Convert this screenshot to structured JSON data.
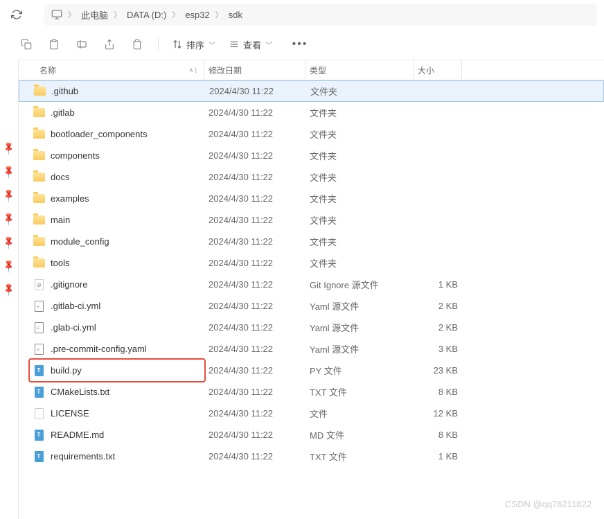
{
  "breadcrumb": {
    "items": [
      "此电脑",
      "DATA (D:)",
      "esp32",
      "sdk"
    ]
  },
  "toolbar": {
    "sort": "排序",
    "view": "查看"
  },
  "columns": {
    "name": "名称",
    "date": "修改日期",
    "type": "类型",
    "size": "大小"
  },
  "files": [
    {
      "name": ".github",
      "date": "2024/4/30 11:22",
      "type": "文件夹",
      "size": "",
      "icon": "folder",
      "selected": true
    },
    {
      "name": ".gitlab",
      "date": "2024/4/30 11:22",
      "type": "文件夹",
      "size": "",
      "icon": "folder"
    },
    {
      "name": "bootloader_components",
      "date": "2024/4/30 11:22",
      "type": "文件夹",
      "size": "",
      "icon": "folder"
    },
    {
      "name": "components",
      "date": "2024/4/30 11:22",
      "type": "文件夹",
      "size": "",
      "icon": "folder"
    },
    {
      "name": "docs",
      "date": "2024/4/30 11:22",
      "type": "文件夹",
      "size": "",
      "icon": "folder"
    },
    {
      "name": "examples",
      "date": "2024/4/30 11:22",
      "type": "文件夹",
      "size": "",
      "icon": "folder"
    },
    {
      "name": "main",
      "date": "2024/4/30 11:22",
      "type": "文件夹",
      "size": "",
      "icon": "folder"
    },
    {
      "name": "module_config",
      "date": "2024/4/30 11:22",
      "type": "文件夹",
      "size": "",
      "icon": "folder"
    },
    {
      "name": "tools",
      "date": "2024/4/30 11:22",
      "type": "文件夹",
      "size": "",
      "icon": "folder"
    },
    {
      "name": ".gitignore",
      "date": "2024/4/30 11:22",
      "type": "Git Ignore 源文件",
      "size": "1 KB",
      "icon": "git"
    },
    {
      "name": ".gitlab-ci.yml",
      "date": "2024/4/30 11:22",
      "type": "Yaml 源文件",
      "size": "2 KB",
      "icon": "txt"
    },
    {
      "name": ".glab-ci.yml",
      "date": "2024/4/30 11:22",
      "type": "Yaml 源文件",
      "size": "2 KB",
      "icon": "txt"
    },
    {
      "name": ".pre-commit-config.yaml",
      "date": "2024/4/30 11:22",
      "type": "Yaml 源文件",
      "size": "3 KB",
      "icon": "txt"
    },
    {
      "name": "build.py",
      "date": "2024/4/30 11:22",
      "type": "PY 文件",
      "size": "23 KB",
      "icon": "blue",
      "highlighted": true
    },
    {
      "name": "CMakeLists.txt",
      "date": "2024/4/30 11:22",
      "type": "TXT 文件",
      "size": "8 KB",
      "icon": "blue"
    },
    {
      "name": "LICENSE",
      "date": "2024/4/30 11:22",
      "type": "文件",
      "size": "12 KB",
      "icon": "file"
    },
    {
      "name": "README.md",
      "date": "2024/4/30 11:22",
      "type": "MD 文件",
      "size": "8 KB",
      "icon": "blue"
    },
    {
      "name": "requirements.txt",
      "date": "2024/4/30 11:22",
      "type": "TXT 文件",
      "size": "1 KB",
      "icon": "blue"
    }
  ],
  "watermark": "CSDN @qq76211822"
}
